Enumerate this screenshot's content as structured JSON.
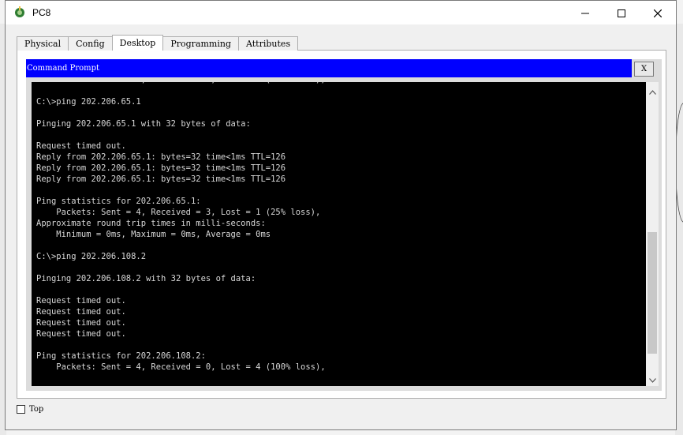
{
  "window": {
    "title": "PC8",
    "icon": "packet-tracer-pc-icon",
    "controls": [
      "minimize-icon",
      "maximize-icon",
      "close-icon"
    ]
  },
  "tabs": [
    {
      "label": "Physical",
      "active": false
    },
    {
      "label": "Config",
      "active": false
    },
    {
      "label": "Desktop",
      "active": true
    },
    {
      "label": "Programming",
      "active": false
    },
    {
      "label": "Attributes",
      "active": false
    }
  ],
  "command_prompt": {
    "title": "Command Prompt",
    "close_label": "X",
    "lines": [
      "    Packets: Sent = 4, Received = 0, Lost = 4 (100% loss),",
      "",
      "C:\\>ping 202.206.65.1",
      "",
      "Pinging 202.206.65.1 with 32 bytes of data:",
      "",
      "Request timed out.",
      "Reply from 202.206.65.1: bytes=32 time<1ms TTL=126",
      "Reply from 202.206.65.1: bytes=32 time<1ms TTL=126",
      "Reply from 202.206.65.1: bytes=32 time<1ms TTL=126",
      "",
      "Ping statistics for 202.206.65.1:",
      "    Packets: Sent = 4, Received = 3, Lost = 1 (25% loss),",
      "Approximate round trip times in milli-seconds:",
      "    Minimum = 0ms, Maximum = 0ms, Average = 0ms",
      "",
      "C:\\>ping 202.206.108.2",
      "",
      "Pinging 202.206.108.2 with 32 bytes of data:",
      "",
      "Request timed out.",
      "Request timed out.",
      "Request timed out.",
      "Request timed out.",
      "",
      "Ping statistics for 202.206.108.2:",
      "    Packets: Sent = 4, Received = 0, Lost = 4 (100% loss),"
    ]
  },
  "bottom": {
    "top_checkbox_label": "Top",
    "top_checked": false
  },
  "colors": {
    "cmd_header": "#0000ff",
    "terminal_bg": "#000000",
    "terminal_text": "#d8d8d8"
  }
}
